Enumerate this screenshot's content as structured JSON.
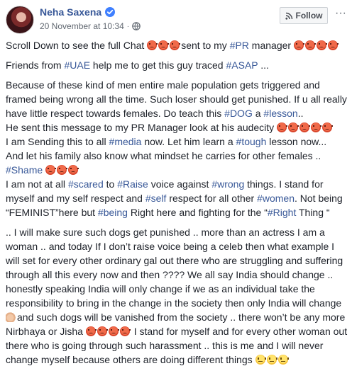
{
  "post": {
    "author": "Neha Saxena",
    "date": "20 November at 10:34",
    "follow_label": "Follow",
    "more_label": "···",
    "p1_a": "Scroll Down to see the full Chat ",
    "p1_b": "sent to my ",
    "p1_tag": "#PR",
    "p1_c": " manager ",
    "p2_a": "Friends from ",
    "p2_tag1": "#UAE",
    "p2_b": " help me to get this guy traced ",
    "p2_tag2": "#ASAP",
    "p2_c": " ...",
    "p3_a": "Because of these kind of men entire male population gets triggered and framed being wrong all the time. Such loser should get punished. If u all really have little respect towards females. Do teach this ",
    "p3_tag1": "#DOG",
    "p3_b": " a ",
    "p3_tag2": "#lesson",
    "p3_c": "..",
    "p3_d": "He sent this message to my PR Manager look at his audecity ",
    "p3_e": "I am Sending this to all ",
    "p3_tag3": "#media",
    "p3_f": " now. Let him learn a ",
    "p3_tag4": "#tough",
    "p3_g": " lesson now...",
    "p3_h": "And let his family also know what mindset he carries for other females ..",
    "p3_tag5": "#Shame",
    "p4_a": "I am not at all ",
    "p4_tag1": "#scared",
    "p4_b": " to ",
    "p4_tag2": "#Raise",
    "p4_c": " voice against ",
    "p4_tag3": "#wrong",
    "p4_d": " things. I stand for myself and my self respect and ",
    "p4_tag4": "#self",
    "p4_e": " respect for all other ",
    "p4_tag5": "#women",
    "p4_f": ". Not being “FEMINIST”here but ",
    "p4_tag6": "#being",
    "p4_g": " Right here and fighting for the “",
    "p4_tag7": "#Right",
    "p4_h": " Thing “",
    "p5_a": ".. I will make sure such dogs get punished .. more than an actress I am a woman .. and today If I don’t raise voice being a celeb then what example I will set for every other ordinary gal out there who are struggling and suffering through all this every now and then ???? We all say India should change .. honestly speaking India will only change if we as an individual take the responsibility to bring in the change in the society then only India will change ",
    "p5_b": "and such dogs will be vanished from the society .. there won’t be any more Nirbhaya or Jisha ",
    "p5_c": " I stand for myself and for every other woman out there who is going through such harassment .. this is me and I will never change myself because others are doing different things "
  },
  "colors": {
    "link": "#385898",
    "text": "#1d2129",
    "meta": "#606770",
    "verified": "#4080ff"
  },
  "icons": [
    "verified-badge-icon",
    "globe-icon",
    "rss-icon",
    "angry-face-emoji",
    "neutral-face-emoji",
    "flexed-arm-emoji"
  ]
}
